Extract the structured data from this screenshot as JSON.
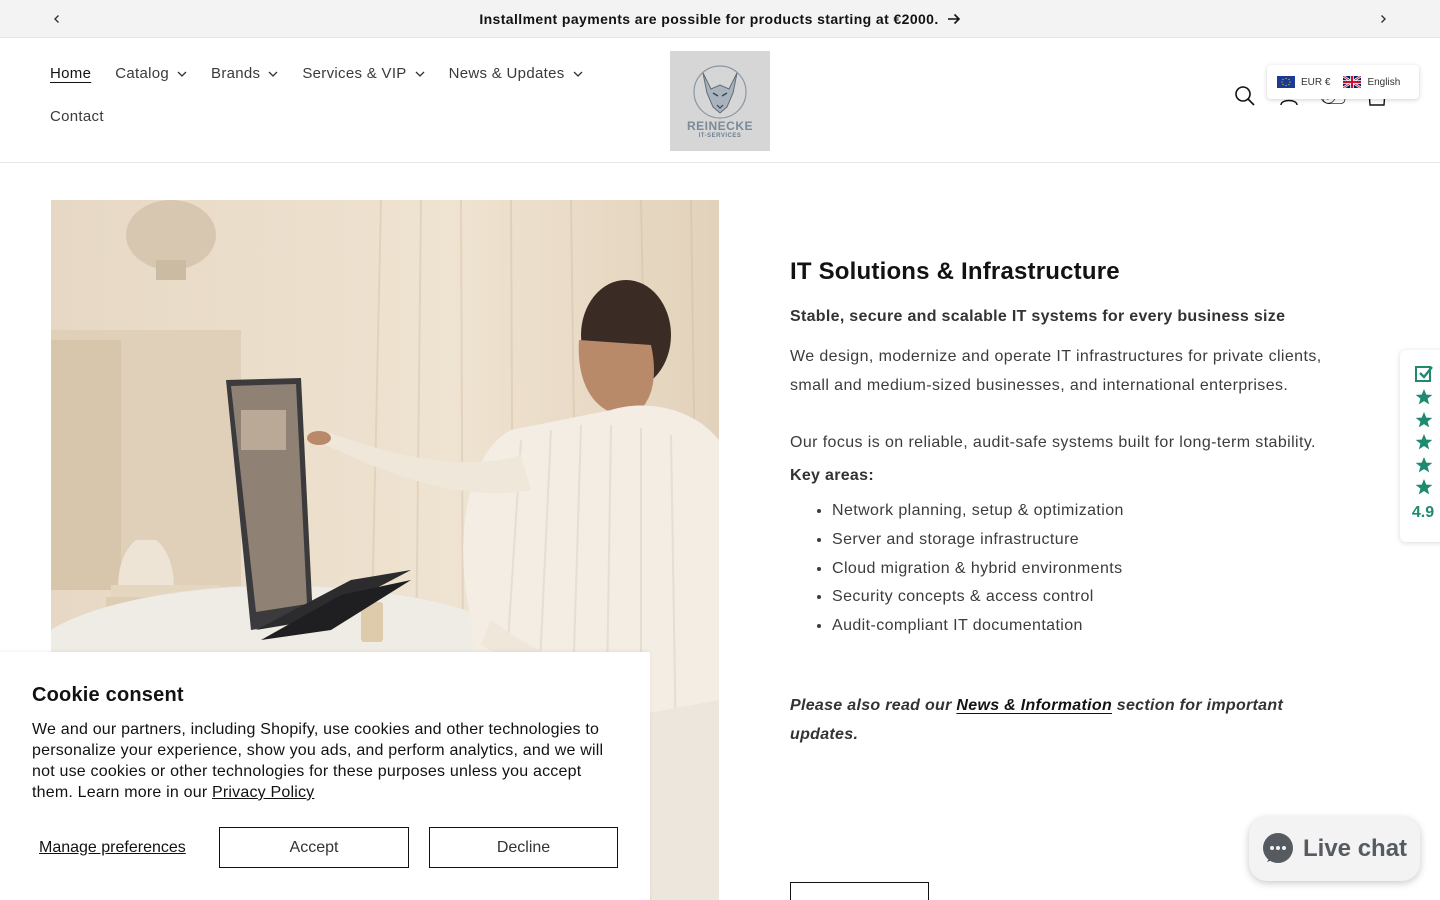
{
  "announcement": {
    "text": "Installment payments are possible for products starting at €2000.",
    "prev_icon": "chevron-left-icon",
    "next_icon": "chevron-right-icon",
    "arrow_icon": "arrow-right-icon"
  },
  "nav": {
    "home": "Home",
    "catalog": "Catalog",
    "brands": "Brands",
    "services": "Services & VIP",
    "news": "News & Updates",
    "contact": "Contact"
  },
  "logo": {
    "brand": "REINECKE",
    "sub": "IT-SERVICES"
  },
  "switcher": {
    "currency": "EUR €",
    "language": "English"
  },
  "hero": {
    "title": "IT Solutions & Infrastructure",
    "lead": "Stable, secure and scalable IT systems for every business size",
    "p1": "We design, modernize and operate IT infrastructures for private clients, small and medium-sized businesses, and international enterprises.",
    "p2": "Our focus is on reliable, audit-safe systems built for long-term stability.",
    "key_heading": "Key areas:",
    "key_areas": [
      "Network planning, setup & optimization",
      "Server and storage infrastructure",
      "Cloud migration & hybrid environments",
      "Security concepts & access control",
      "Audit-compliant IT documentation"
    ],
    "note_before": "Please also read our ",
    "note_link": "News & Information",
    "note_after": " section for important updates."
  },
  "reviews": {
    "score": "4.9"
  },
  "cookie": {
    "title": "Cookie consent",
    "text": "We and our partners, including Shopify, use cookies and other technologies to personalize your experience, show you ads, and perform analytics, and we will not use cookies or other technologies for these purposes unless you accept them. Learn more in our ",
    "privacy_link": "Privacy Policy",
    "manage": "Manage preferences",
    "accept": "Accept",
    "decline": "Decline"
  },
  "chat": {
    "label": "Live chat"
  },
  "colors": {
    "accent_green": "#1f8a70",
    "announcement_bg": "#f3f3f3",
    "text": "#121212"
  }
}
